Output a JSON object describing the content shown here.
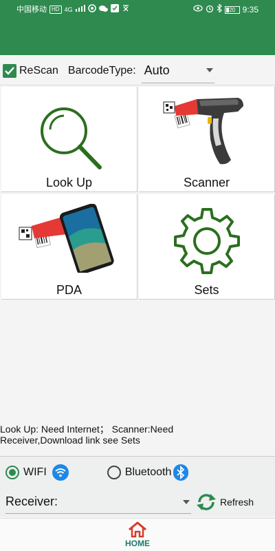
{
  "status_bar": {
    "carrier": "中国移动",
    "hd_badge": "HD",
    "network": "4G",
    "time": "9:35",
    "battery": "20"
  },
  "toolbar": {
    "rescan_label": "ReScan",
    "rescan_checked": true,
    "barcode_type_label": "BarcodeType:",
    "barcode_type_value": "Auto"
  },
  "tiles": [
    {
      "label": "Look Up",
      "icon": "magnifier-icon"
    },
    {
      "label": "Scanner",
      "icon": "barcode-scanner-icon"
    },
    {
      "label": "PDA",
      "icon": "pda-phone-icon"
    },
    {
      "label": "Sets",
      "icon": "gear-icon"
    }
  ],
  "notice": {
    "line1": "Look Up: Need Internet； Scanner:Need",
    "line2": "Receiver,Download link see Sets"
  },
  "connection": {
    "wifi_label": "WIFI",
    "wifi_selected": true,
    "bluetooth_label": "Bluetooth",
    "bluetooth_selected": false
  },
  "receiver": {
    "label": "Receiver:",
    "refresh_label": "Refresh"
  },
  "bottom_nav": {
    "home_label": "HOME"
  },
  "colors": {
    "brand_green": "#2f8a4f",
    "home_teal": "#1a7a6a",
    "home_red": "#d43a2a",
    "scan_red": "#e53935",
    "wifi_blue": "#1e88e5"
  }
}
